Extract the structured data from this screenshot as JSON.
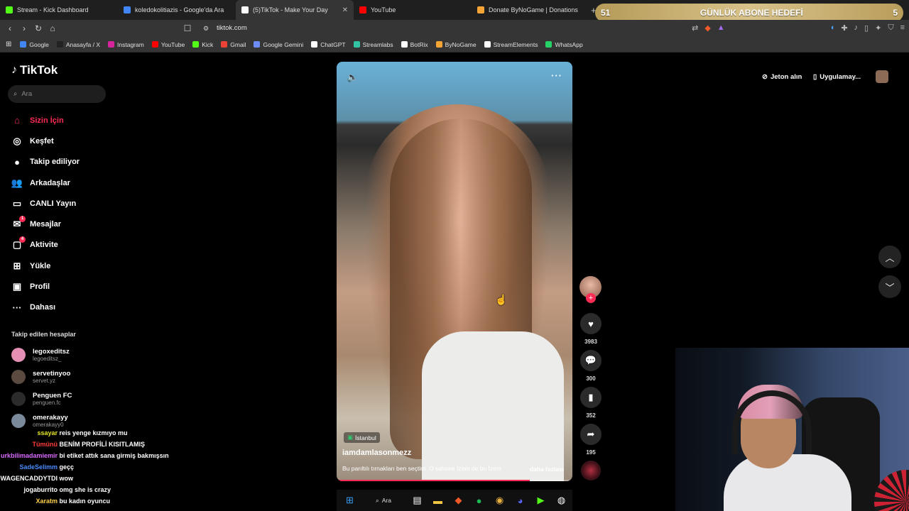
{
  "browser": {
    "tabs": [
      {
        "label": "Stream - Kick Dashboard",
        "color": "#53fc18",
        "active": false
      },
      {
        "label": "koledokolitiazis - Google'da Ara",
        "color": "#4285f4",
        "active": false
      },
      {
        "label": "(5)TikTok - Make Your Day",
        "color": "#ffffff",
        "active": true
      },
      {
        "label": "YouTube",
        "color": "#ff0000",
        "active": false
      },
      {
        "label": "Donate ByNoGame | Donations",
        "color": "#f4a535",
        "active": false
      }
    ],
    "new_tab": "+",
    "url": "tiktok.com",
    "bookmarks": [
      {
        "label": "Google",
        "color": "#4285f4"
      },
      {
        "label": "Anasayfa / X",
        "color": "#222222"
      },
      {
        "label": "Instagram",
        "color": "#d6249f"
      },
      {
        "label": "YouTube",
        "color": "#ff0000"
      },
      {
        "label": "Kick",
        "color": "#53fc18"
      },
      {
        "label": "Gmail",
        "color": "#ea4335"
      },
      {
        "label": "Google Gemini",
        "color": "#6d8cf7"
      },
      {
        "label": "ChatGPT",
        "color": "#ffffff"
      },
      {
        "label": "Streamlabs",
        "color": "#31c3a2"
      },
      {
        "label": "BotRix",
        "color": "#ffffff"
      },
      {
        "label": "ByNoGame",
        "color": "#f4a535"
      },
      {
        "label": "StreamElements",
        "color": "#ffffff"
      },
      {
        "label": "WhatsApp",
        "color": "#25d366"
      }
    ]
  },
  "goal_overlay": {
    "left": "51",
    "title": "GÜNLÜK ABONE HEDEFİ",
    "right": "5"
  },
  "tiktok": {
    "logo": "TikTok",
    "search_placeholder": "Ara",
    "nav": [
      {
        "label": "Sizin İçin",
        "icon": "home-icon",
        "glyph": "⌂",
        "active": true
      },
      {
        "label": "Keşfet",
        "icon": "compass-icon",
        "glyph": "◎"
      },
      {
        "label": "Takip ediliyor",
        "icon": "following-avatar-icon",
        "glyph": "●"
      },
      {
        "label": "Arkadaşlar",
        "icon": "friends-icon",
        "glyph": "👥"
      },
      {
        "label": "CANLI Yayın",
        "icon": "live-icon",
        "glyph": "▭"
      },
      {
        "label": "Mesajlar",
        "icon": "messages-icon",
        "glyph": "✉",
        "badge": "1"
      },
      {
        "label": "Aktivite",
        "icon": "activity-icon",
        "glyph": "▢",
        "badge": "4"
      },
      {
        "label": "Yükle",
        "icon": "upload-icon",
        "glyph": "⊞"
      },
      {
        "label": "Profil",
        "icon": "profile-icon",
        "glyph": "▣"
      },
      {
        "label": "Dahası",
        "icon": "more-icon",
        "glyph": "···"
      }
    ],
    "following_title": "Takip edilen hesaplar",
    "accounts": [
      {
        "name": "legoxeditsz",
        "handle": "legoeditsz_",
        "color": "#e58fb5"
      },
      {
        "name": "servetinyoo",
        "handle": "servet.yz",
        "color": "#5a4a40"
      },
      {
        "name": "Penguen FC",
        "handle": "penguen.fc",
        "color": "#2b2b2b"
      },
      {
        "name": "omerakayy",
        "handle": "omerakayy0",
        "color": "#7a8a9a"
      }
    ],
    "top_right": {
      "coins": "Jeton alın",
      "app": "Uygulamay..."
    },
    "video": {
      "location": "İstanbul",
      "username": "iamdamlasonmezz",
      "description": "Bu parıltılı tırnakları ben seçtim. O şahane İzem de bu İzem",
      "more": "daha fazlası",
      "progress": 0.82
    },
    "actions": {
      "likes": "3983",
      "comments": "300",
      "saves": "352",
      "shares": "195"
    }
  },
  "chat": [
    {
      "user": "ssayar",
      "msg": "reis yenge kızmıyo mu",
      "ucolor": "#e5e52a"
    },
    {
      "user": "Tümünü",
      "msg": "BENİM PROFİLİ KISITLAMIŞ",
      "ucolor": "#ff3b3b"
    },
    {
      "user": "urkbilimadamiemir",
      "msg": "bi etiket attık sana girmiş bakmışsın",
      "ucolor": "#d96bff"
    },
    {
      "user": "SadeSelimm",
      "msg": "geçç",
      "ucolor": "#4a8cff"
    },
    {
      "user": "WAGENCADDYTDI",
      "msg": "wow",
      "ucolor": "#ffffff"
    },
    {
      "user": "jogaburrito",
      "msg": "omg she is crazy",
      "ucolor": "#ffffff"
    },
    {
      "user": "Xaratm",
      "msg": "bu kadın oyuncu",
      "ucolor": "#ffd24a"
    }
  ],
  "taskbar": {
    "search": "Ara"
  }
}
